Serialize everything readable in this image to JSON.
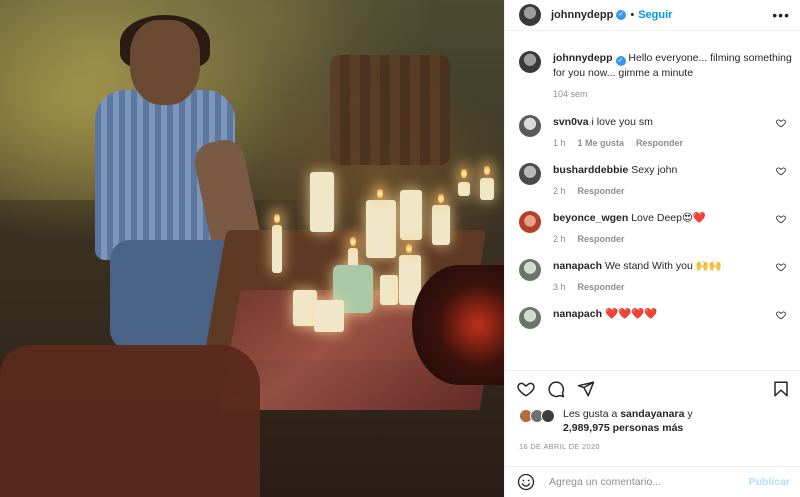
{
  "post": {
    "author": "johnnydepp",
    "follow_label": "Seguir",
    "more_label": "•••",
    "caption": "Hello everyone... filming something for you now... gimme a minute",
    "caption_age": "104 sem"
  },
  "comments": [
    {
      "user": "svn0va",
      "text": "i love you sm",
      "age": "1 h",
      "likes": "1 Me gusta",
      "reply": "Responder",
      "avatar_color": "#c9c9c9"
    },
    {
      "user": "busharddebbie",
      "text": "Sexy john",
      "age": "2 h",
      "likes": "",
      "reply": "Responder",
      "avatar_color": "#8f8f8f"
    },
    {
      "user": "beyonce_wgen",
      "text": "Love Deep😍❤️",
      "age": "2 h",
      "likes": "",
      "reply": "Responder",
      "avatar_color": "#c0553a"
    },
    {
      "user": "nanapach",
      "text": "We stand With you 🙌🙌",
      "age": "3 h",
      "likes": "",
      "reply": "Responder",
      "avatar_color": "#9aa29a"
    },
    {
      "user": "nanapach",
      "text": "❤️❤️❤️❤️",
      "age": "",
      "likes": "",
      "reply": "",
      "avatar_color": "#9aa29a"
    }
  ],
  "likes": {
    "line1_prefix": "Les gusta a",
    "line1_user": "sandayanara",
    "line1_suffix": "y",
    "line2": "2,989,975 personas más",
    "avatar_colors": [
      "#b56b3a",
      "#6f6f6f",
      "#3e3e3e"
    ]
  },
  "date": "16 DE ABRIL DE 2020",
  "composer": {
    "placeholder": "Agrega un comentario...",
    "post_label": "Publicar"
  },
  "colors": {
    "accent": "#0095f6",
    "verified": "#3897f0",
    "muted": "#8e8e8e",
    "post_disabled": "#b2dffc"
  },
  "icons": [
    "heart-icon",
    "comment-icon",
    "share-icon",
    "bookmark-icon",
    "emoji-icon",
    "verified-badge-icon",
    "more-options-icon"
  ]
}
